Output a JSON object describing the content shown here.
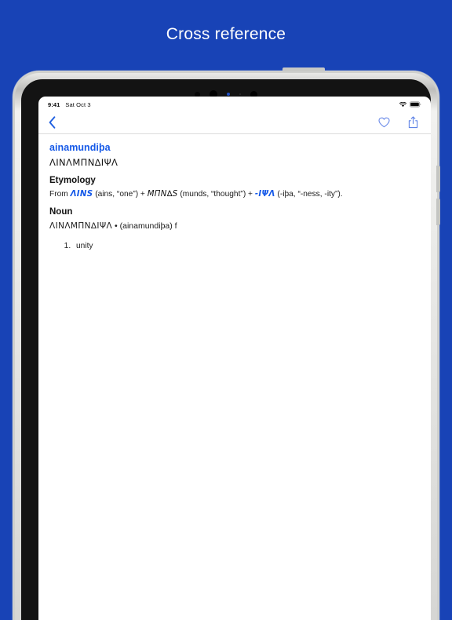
{
  "caption": "Cross reference",
  "theme": {
    "background": "#1843b6",
    "accent": "#1559e8",
    "screen": "#ffffff",
    "bezel": "#131313",
    "frame": "#cfd0cd"
  },
  "device": {
    "status_bar": {
      "time": "9:41",
      "date": "Sat Oct 3",
      "wifi_icon": "wifi-icon",
      "battery_icon": "battery-icon"
    },
    "nav_bar": {
      "back_icon": "chevron-left-icon",
      "favorite_icon": "heart-icon",
      "share_icon": "share-icon"
    }
  },
  "article": {
    "headword": "ainamundiþa",
    "headword_gothic": "ΛΙΝΛМПΝ∆ΙΨΛ",
    "etymology": {
      "heading": "Etymology",
      "prefix": "From ",
      "root1_gothic": "ΛINS",
      "root1_gloss": " (ains, “one”) + ",
      "root2_gothic": "МПΝ∆S",
      "root2_gloss": " (munds, “thought”) + ",
      "suffix_gothic": "-IΨΛ",
      "suffix_gloss": " (-iþa, “-ness, -ity”)."
    },
    "noun": {
      "heading": "Noun",
      "gothic": "ΛΙΝΛМПΝ∆ΙΨΛ",
      "separator": " • ",
      "transliteration": "(ainamundiþa)",
      "gender": " f",
      "definitions": [
        "unity"
      ]
    }
  }
}
